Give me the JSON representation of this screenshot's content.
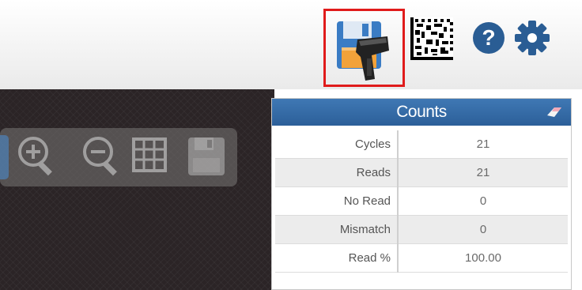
{
  "toolbar": {
    "icons": [
      "save-scanner-settings-icon",
      "datamatrix-code-icon",
      "help-icon",
      "gear-icon"
    ],
    "highlight_color": "#e01b1b"
  },
  "viewer": {
    "tools": [
      "zoom-in-icon",
      "zoom-out-icon",
      "grid-icon",
      "save-image-icon"
    ]
  },
  "counts": {
    "title": "Counts",
    "header_color": "#3467a4",
    "rows": [
      {
        "label": "Cycles",
        "value": "21"
      },
      {
        "label": "Reads",
        "value": "21"
      },
      {
        "label": "No Read",
        "value": "0"
      },
      {
        "label": "Mismatch",
        "value": "0"
      },
      {
        "label": "Read %",
        "value": "100.00"
      }
    ]
  }
}
